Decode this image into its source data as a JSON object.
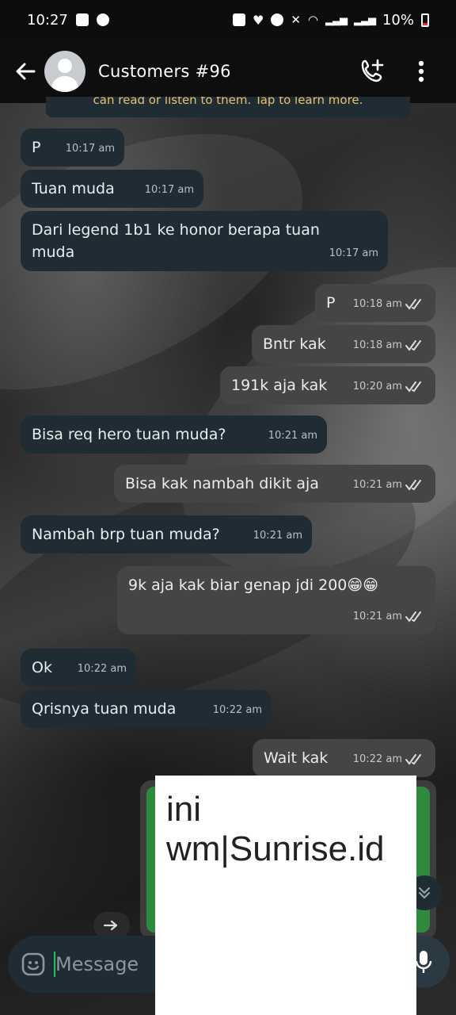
{
  "status_bar": {
    "time": "10:27",
    "battery": "10%"
  },
  "header": {
    "title": "Customers #96"
  },
  "system_notice": {
    "text": "can read or listen to them. Tap to learn more."
  },
  "messages": [
    {
      "text": "P",
      "time": "10:17 am",
      "direction": "in"
    },
    {
      "text": "Tuan muda",
      "time": "10:17 am",
      "direction": "in"
    },
    {
      "text": "Dari legend 1b1 ke honor berapa tuan\nmuda",
      "time": "10:17 am",
      "direction": "in"
    },
    {
      "text": "P",
      "time": "10:18 am",
      "direction": "out"
    },
    {
      "text": "Bntr kak",
      "time": "10:18 am",
      "direction": "out"
    },
    {
      "text": "191k aja kak",
      "time": "10:20 am",
      "direction": "out"
    },
    {
      "text": "Bisa req hero tuan muda?",
      "time": "10:21 am",
      "direction": "in"
    },
    {
      "text": "Bisa kak nambah dikit aja",
      "time": "10:21 am",
      "direction": "out"
    },
    {
      "text": "Nambah brp tuan muda?",
      "time": "10:21 am",
      "direction": "in"
    },
    {
      "text": "9k aja kak biar genap jdi 200😁😁",
      "time": "10:21 am",
      "direction": "out"
    },
    {
      "text": "Ok",
      "time": "10:22 am",
      "direction": "in"
    },
    {
      "text": "Qrisnya tuan muda",
      "time": "10:22 am",
      "direction": "in"
    },
    {
      "text": "Wait kak",
      "time": "10:22 am",
      "direction": "out"
    }
  ],
  "watermark": {
    "line1": "ini",
    "line2": "wm|Sunrise.id"
  },
  "composer": {
    "placeholder": "Message"
  },
  "colors": {
    "incoming_bubble": "#1f2c33",
    "outgoing_bubble": "#454545",
    "accent": "#21c063"
  }
}
